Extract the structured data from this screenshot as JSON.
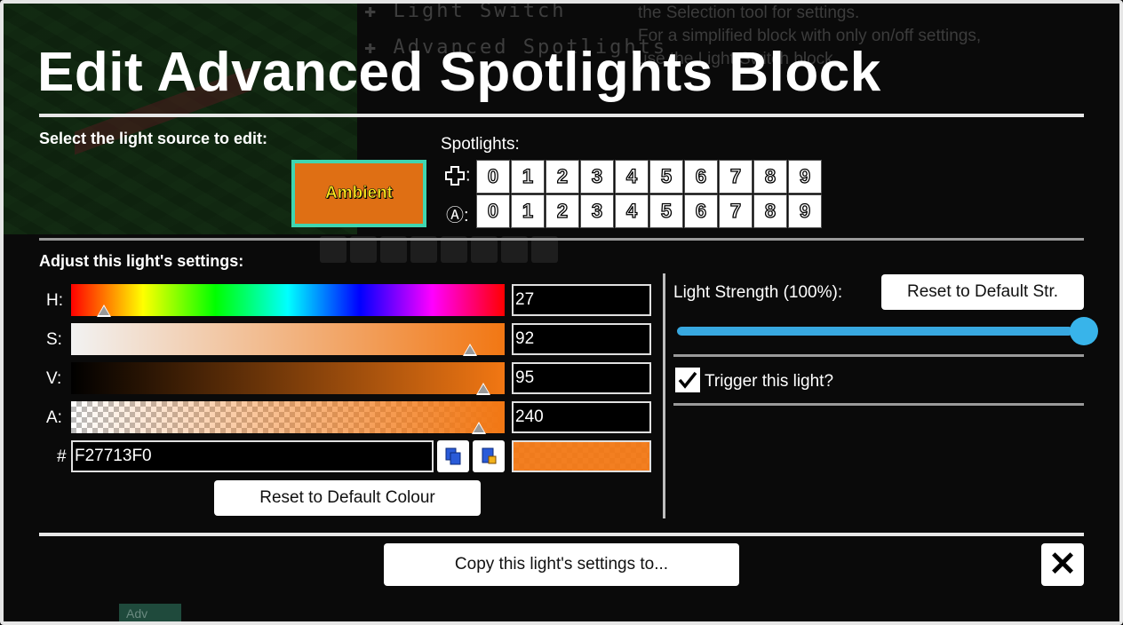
{
  "background": {
    "list_items": [
      "Light Switch",
      "Advanced Spotlights"
    ],
    "help_lines": [
      "the  Selection tool for settings.",
      "For a simplified block with only on/off settings,",
      "use the Light Switch block."
    ],
    "tag": "Adv"
  },
  "dialog": {
    "title": "Edit Advanced Spotlights Block",
    "select_label": "Select the light source to edit:",
    "ambient_label": "Ambient",
    "spotlights_label": "Spotlights:",
    "spot_rows": [
      {
        "icon": "dpad-icon",
        "suffix": ":"
      },
      {
        "icon": "button-a-icon",
        "glyph": "Ⓐ",
        "suffix": ":"
      }
    ],
    "spot_numbers": [
      "0",
      "1",
      "2",
      "3",
      "4",
      "5",
      "6",
      "7",
      "8",
      "9"
    ],
    "adjust_label": "Adjust this light's settings:",
    "sliders": {
      "h": {
        "label": "H:",
        "value": "27",
        "level": 0.075
      },
      "s": {
        "label": "S:",
        "value": "92",
        "level": 0.92
      },
      "v": {
        "label": "V:",
        "value": "95",
        "level": 0.95
      },
      "a": {
        "label": "A:",
        "value": "240",
        "level": 0.94
      }
    },
    "hex_prefix": "#",
    "hex_value": "F27713F0",
    "reset_colour_label": "Reset to Default Colour",
    "strength_label": "Light Strength (100%):",
    "strength_level": 1.0,
    "reset_strength_label": "Reset to Default Str.",
    "trigger_label": "Trigger this light?",
    "trigger_checked": true,
    "copy_label": "Copy this light's settings to...",
    "close_glyph": "✕"
  },
  "colors": {
    "current": "#F27713",
    "ambient_fill": "#DF6F14",
    "ambient_border": "#3FD6B0",
    "ambient_text": "#FFE81A",
    "accent": "#38A8E0"
  }
}
